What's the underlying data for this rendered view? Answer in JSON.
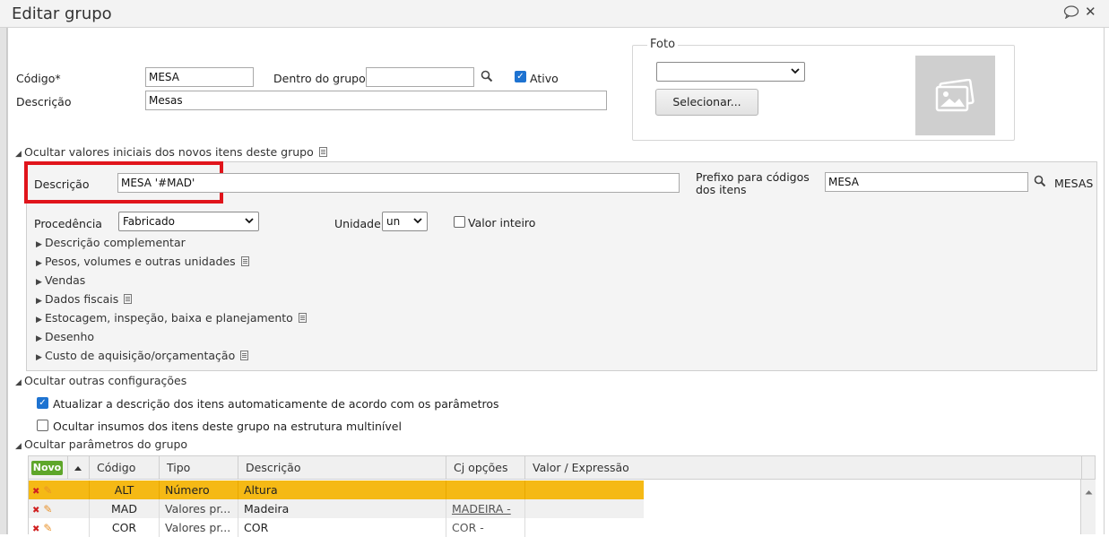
{
  "dialog": {
    "title": "Editar grupo"
  },
  "fields": {
    "codigo_label": "Código*",
    "codigo_value": "MESA",
    "dentro_label": "Dentro do grupo",
    "dentro_value": "",
    "ativo_label": "Ativo",
    "descricao_label": "Descrição",
    "descricao_value": "Mesas"
  },
  "foto": {
    "legend": "Foto",
    "select_value": "",
    "button_label": "Selecionar..."
  },
  "initial_values": {
    "toggle_label": "Ocultar valores iniciais dos novos itens deste grupo",
    "descricao_label": "Descrição",
    "descricao_value": "MESA '#MAD'",
    "prefixo_label_line1": "Prefixo para códigos",
    "prefixo_label_line2": "dos itens",
    "prefixo_value": "MESA",
    "prefixo_suffix": "MESAS",
    "procedencia_label": "Procedência",
    "procedencia_value": "Fabricado",
    "unidade_label": "Unidade",
    "unidade_value": "un",
    "valor_inteiro_label": "Valor inteiro",
    "subsections": [
      "Descrição complementar",
      "Pesos, volumes e outras unidades",
      "Vendas",
      "Dados fiscais",
      "Estocagem, inspeção, baixa e planejamento",
      "Desenho",
      "Custo de aquisição/orçamentação"
    ]
  },
  "other_config": {
    "toggle_label": "Ocultar outras configurações",
    "option1_label": "Atualizar a descrição dos itens automaticamente de acordo com os parâmetros",
    "option2_label": "Ocultar insumos dos itens deste grupo na estrutura multinível"
  },
  "params": {
    "toggle_label": "Ocultar parâmetros do grupo",
    "novo_label": "Novo",
    "columns": [
      "Código",
      "Tipo",
      "Descrição",
      "Cj opções",
      "Valor / Expressão"
    ],
    "rows": [
      {
        "codigo": "ALT",
        "tipo": "Número",
        "descricao": "Altura",
        "cj": "",
        "valor": ""
      },
      {
        "codigo": "MAD",
        "tipo": "Valores pr...",
        "descricao": "Madeira",
        "cj": "MADEIRA -",
        "valor": ""
      },
      {
        "codigo": "COR",
        "tipo": "Valores pr...",
        "descricao": "COR",
        "cj": "COR -",
        "valor": ""
      }
    ]
  },
  "colors": {
    "selected_row": "#f5b915",
    "highlight_box": "#e0141b",
    "checkbox_blue": "#1e73d1",
    "novo_green": "#5ea62a"
  },
  "icons": [
    "comment-icon",
    "close-icon",
    "search-icon",
    "image-placeholder-icon",
    "delete-icon",
    "edit-pencil-icon",
    "sort-up-icon",
    "scroll-up-icon"
  ]
}
